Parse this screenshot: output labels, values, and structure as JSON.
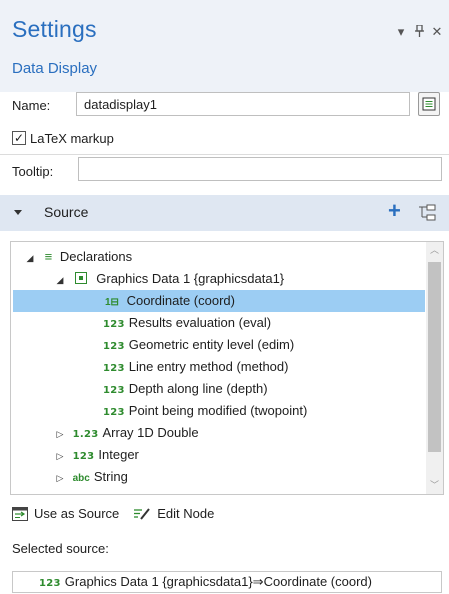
{
  "header": {
    "title": "Settings",
    "subtitle": "Data Display",
    "window_controls": [
      "chevron-down-icon",
      "pin-icon",
      "close-icon"
    ]
  },
  "name_field": {
    "label": "Name:",
    "value": "datadisplay1"
  },
  "latex": {
    "label": "LaTeX markup",
    "checked": true
  },
  "tooltip_field": {
    "label": "Tooltip:",
    "value": ""
  },
  "source_section": {
    "title": "Source"
  },
  "tree": {
    "items": [
      {
        "label": "Declarations",
        "icon": "list-icon",
        "expander": "expanded"
      },
      {
        "label": "Graphics Data 1 {graphicsdata1}",
        "icon": "graphics-data-icon",
        "expander": "expanded"
      },
      {
        "label": "Coordinate (coord)",
        "icon": "coordinate-icon",
        "selected": true
      },
      {
        "label": "Results evaluation (eval)",
        "icon_text": "123"
      },
      {
        "label": "Geometric entity level (edim)",
        "icon_text": "123"
      },
      {
        "label": "Line entry method (method)",
        "icon_text": "123"
      },
      {
        "label": "Depth along line (depth)",
        "icon_text": "123"
      },
      {
        "label": "Point being modified (twopoint)",
        "icon_text": "123"
      },
      {
        "label": "Array 1D Double",
        "icon_text": "1.23",
        "expander": "collapsed"
      },
      {
        "label": "Integer",
        "icon_text": "123",
        "expander": "collapsed"
      },
      {
        "label": "String",
        "icon_text": "abc",
        "expander": "collapsed"
      }
    ]
  },
  "actions": {
    "use_as_source": "Use as Source",
    "edit_node": "Edit Node"
  },
  "selected_source": {
    "label": "Selected source:",
    "icon_text": "123",
    "value": "Graphics Data 1 {graphicsdata1}⇒Coordinate (coord)"
  },
  "colors": {
    "accent": "#2a6fbf",
    "selection": "#9ccdf3",
    "icon_green": "#2e8b2e",
    "section_bg": "#dfe7f2"
  }
}
